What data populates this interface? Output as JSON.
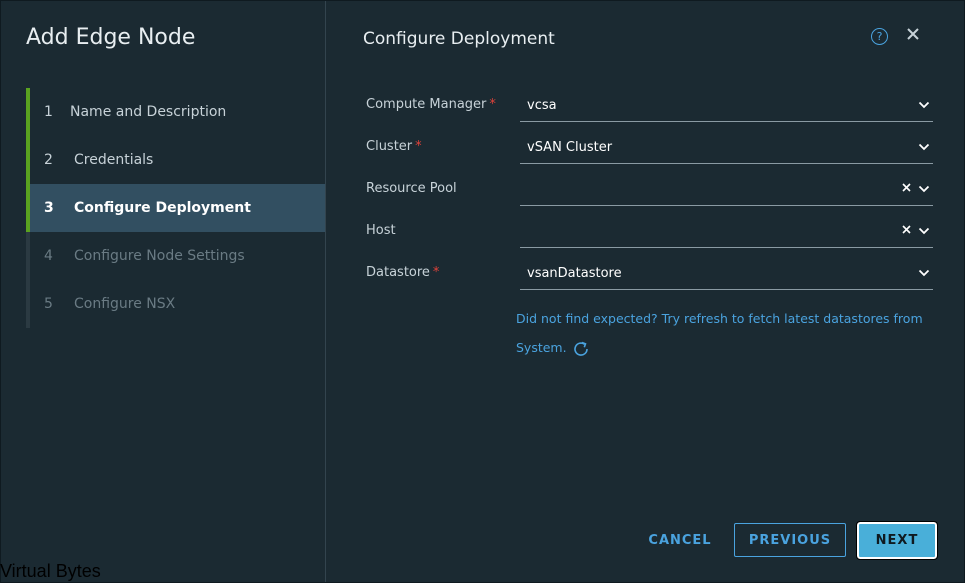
{
  "wizard": {
    "title": "Add Edge Node",
    "steps": [
      {
        "num": "1",
        "label": "Name and Description",
        "state": "done"
      },
      {
        "num": "2",
        "label": "Credentials",
        "state": "done"
      },
      {
        "num": "3",
        "label": "Configure Deployment",
        "state": "active"
      },
      {
        "num": "4",
        "label": "Configure Node Settings",
        "state": "pending"
      },
      {
        "num": "5",
        "label": "Configure NSX",
        "state": "pending"
      }
    ]
  },
  "page": {
    "title": "Configure Deployment",
    "help_icon": "help-icon",
    "close_icon": "close-icon"
  },
  "form": {
    "compute_manager": {
      "label": "Compute Manager",
      "required": "*",
      "value": "vcsa"
    },
    "cluster": {
      "label": "Cluster",
      "required": "*",
      "value": "vSAN Cluster"
    },
    "resource_pool": {
      "label": "Resource Pool",
      "value": ""
    },
    "host": {
      "label": "Host",
      "value": ""
    },
    "datastore": {
      "label": "Datastore",
      "required": "*",
      "value": "vsanDatastore"
    },
    "hint": "Did not find expected? Try refresh to fetch latest datastores from System."
  },
  "buttons": {
    "cancel": "CANCEL",
    "previous": "PREVIOUS",
    "next": "NEXT"
  },
  "watermark": "Virtual Bytes",
  "colors": {
    "accent": "#49afd9",
    "step_complete": "#5aa220",
    "required": "#e0423a",
    "background": "#1b2a32",
    "active_step": "#324f61"
  }
}
